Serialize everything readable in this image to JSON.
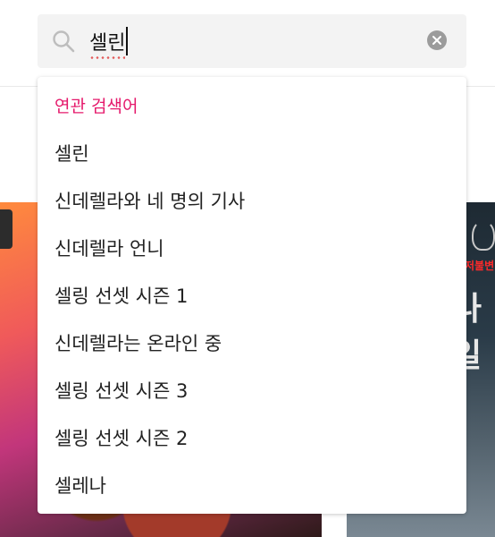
{
  "search": {
    "query": "셀린"
  },
  "dropdown": {
    "title": "연관 검색어",
    "items": [
      "셀린",
      "신데렐라와 네 명의 기사",
      "신데렐라 언니",
      "셀링 선셋 시즌 1",
      "신데렐라는 온라인 중",
      "셀링 선셋 시즌 3",
      "셀링 선셋 시즌 2",
      "셀레나"
    ]
  },
  "background": {
    "right_poster_red_text": "저불변",
    "right_poster_big_text": "나일"
  },
  "colors": {
    "accent": "#e5196b",
    "search_bg": "#f3f3f3",
    "clear_button": "#9b9b9b"
  }
}
